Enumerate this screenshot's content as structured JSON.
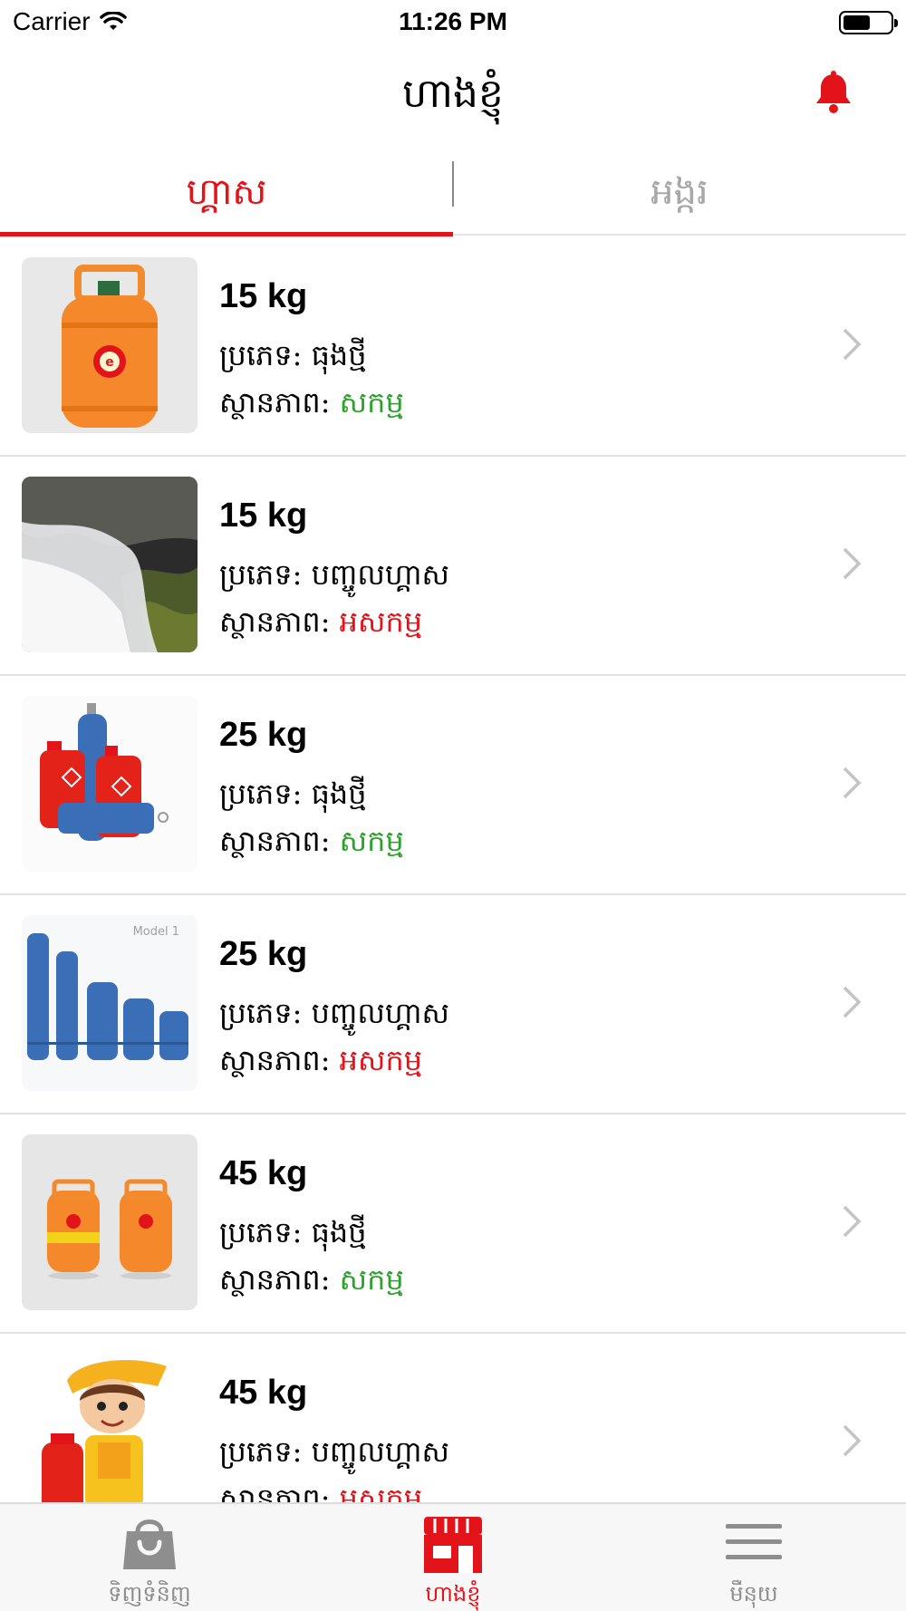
{
  "status_bar": {
    "carrier": "Carrier",
    "time": "11:26 PM"
  },
  "header": {
    "title": "ហាងខ្ញុំ",
    "bell_icon": "bell-icon"
  },
  "tabs": [
    {
      "label": "ហ្គាស",
      "active": true
    },
    {
      "label": "អង្ករ",
      "active": false
    }
  ],
  "labels": {
    "type": "ប្រភេទ: ",
    "status": "ស្ថានភាព: "
  },
  "items": [
    {
      "weight": "15 kg",
      "type": "ធុងថ្មី",
      "status": "សកម្ម",
      "active": true
    },
    {
      "weight": "15 kg",
      "type": "បញ្ចូលហ្គាស",
      "status": "អសកម្ម",
      "active": false
    },
    {
      "weight": "25 kg",
      "type": "ធុងថ្មី",
      "status": "សកម្ម",
      "active": true
    },
    {
      "weight": "25 kg",
      "type": "បញ្ចូលហ្គាស",
      "status": "អសកម្ម",
      "active": false,
      "image_text": "Model 1"
    },
    {
      "weight": "45 kg",
      "type": "ធុងថ្មី",
      "status": "សកម្ម",
      "active": true
    },
    {
      "weight": "45 kg",
      "type": "បញ្ចូលហ្គាស",
      "status": "អសកម្ម",
      "active": false
    }
  ],
  "tab_bar": [
    {
      "label": "ទិញទំនិញ",
      "icon": "shopping-bag-icon",
      "active": false
    },
    {
      "label": "ហាងខ្ញុំ",
      "icon": "store-icon",
      "active": true
    },
    {
      "label": "មឺនុយ",
      "icon": "menu-icon",
      "active": false
    }
  ],
  "colors": {
    "accent": "#e3131a",
    "active": "#2aa32a",
    "inactive": "#e3131a",
    "muted": "#a8a8a8"
  }
}
